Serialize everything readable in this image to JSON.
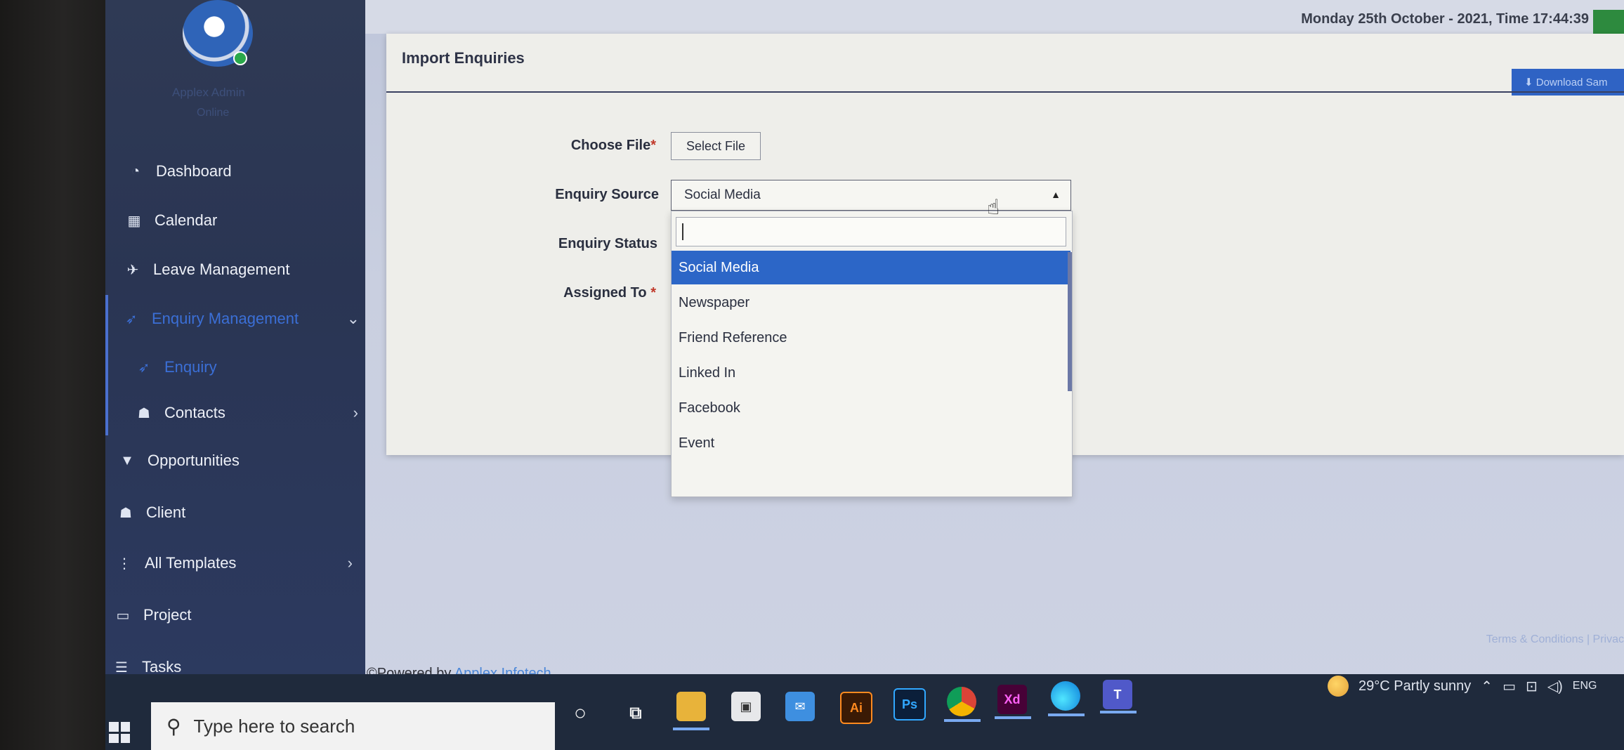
{
  "sidebar": {
    "user_name": "Applex Admin",
    "user_status": "Online",
    "items": [
      {
        "label": "Dashboard",
        "icon": "dashboard-icon"
      },
      {
        "label": "Calendar",
        "icon": "calendar-icon"
      },
      {
        "label": "Leave Management",
        "icon": "plane-icon"
      },
      {
        "label": "Enquiry Management",
        "icon": "rocket-icon"
      },
      {
        "label": "Enquiry",
        "icon": "rocket-icon"
      },
      {
        "label": "Contacts",
        "icon": "users-icon"
      },
      {
        "label": "Opportunities",
        "icon": "filter-icon"
      },
      {
        "label": "Client",
        "icon": "users-icon"
      },
      {
        "label": "All Templates",
        "icon": "vertical-dots-icon"
      },
      {
        "label": "Project",
        "icon": "folder-open-icon"
      },
      {
        "label": "Tasks",
        "icon": "tasks-icon"
      }
    ]
  },
  "header": {
    "datetime": "Monday 25th October - 2021,  Time  17:44:39"
  },
  "card": {
    "title": "Import Enquiries",
    "download_label": "⬇ Download Sam",
    "form": {
      "choose_file_label": "Choose File",
      "select_file_button": "Select File",
      "enquiry_source_label": "Enquiry Source",
      "enquiry_source_value": "Social Media",
      "enquiry_status_label": "Enquiry Status",
      "assigned_to_label": "Assigned To"
    },
    "dropdown": {
      "search_value": "",
      "options": [
        "Social Media",
        "Newspaper",
        "Friend Reference",
        "Linked In",
        "Facebook",
        "Event"
      ],
      "selected": "Social Media"
    }
  },
  "footer": {
    "powered_prefix": "©Powered by ",
    "powered_brand": "Applex Infotech.",
    "terms": "Terms & Conditions | Privac"
  },
  "taskbar": {
    "search_placeholder": "Type here to search",
    "weather": "29°C  Partly sunny",
    "language": "ENG"
  },
  "colors": {
    "accent": "#2c66c7",
    "sidebar_bg": "#2b3654",
    "required": "#c0392b"
  }
}
